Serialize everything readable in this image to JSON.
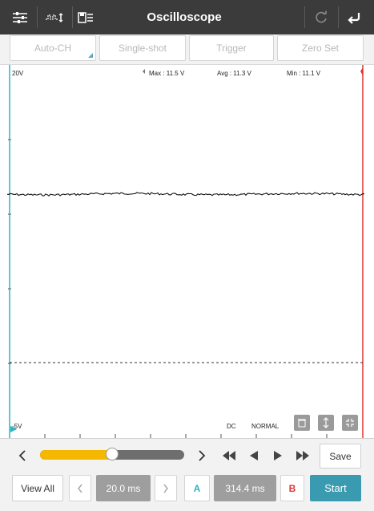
{
  "header": {
    "title": "Oscilloscope",
    "icons": [
      "sliders-icon",
      "waveform-icon",
      "save-list-icon",
      "refresh-icon",
      "back-icon"
    ]
  },
  "toolbar": {
    "auto_ch": "Auto-CH",
    "single_shot": "Single-shot",
    "trigger": "Trigger",
    "zero_set": "Zero Set"
  },
  "scope": {
    "range_top": "20V",
    "range_bottom": "-5V",
    "max": "Max : 11.5 V",
    "avg": "Avg : 11.3 V",
    "min": "Min : 11.1 V",
    "coupling": "DC",
    "mode": "NORMAL",
    "trace_color": "#111111",
    "cursor_a_color": "#2bb5c6",
    "cursor_b_color": "#e03333"
  },
  "playback": {
    "slider_fraction": 0.5,
    "save_label": "Save",
    "slider_color": "#f5b800"
  },
  "bottom": {
    "view_all": "View All",
    "time_div": "20.0 ms",
    "cursor_a": "A",
    "delta": "314.4 ms",
    "cursor_b": "B",
    "start": "Start",
    "start_color": "#3a9bb0"
  }
}
